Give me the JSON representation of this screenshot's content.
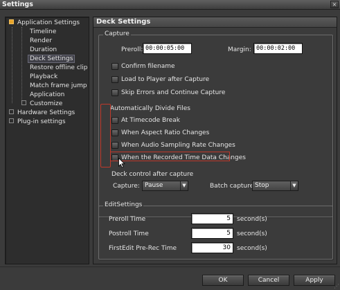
{
  "window": {
    "title": "Settings",
    "close_label": "×"
  },
  "tree": {
    "items": [
      {
        "label": "Application Settings",
        "level": 0
      },
      {
        "label": "Timeline",
        "level": 1
      },
      {
        "label": "Render",
        "level": 1
      },
      {
        "label": "Duration",
        "level": 1
      },
      {
        "label": "Deck Settings",
        "level": 1,
        "selected": true
      },
      {
        "label": "Restore offline clip",
        "level": 1
      },
      {
        "label": "Playback",
        "level": 1
      },
      {
        "label": "Match frame jump",
        "level": 1
      },
      {
        "label": "Application",
        "level": 1
      },
      {
        "label": "Customize",
        "level": 1
      },
      {
        "label": "Hardware Settings",
        "level": 0
      },
      {
        "label": "Plug-in settings",
        "level": 0
      }
    ]
  },
  "panel": {
    "title": "Deck Settings",
    "capture": {
      "legend": "Capture",
      "preroll_label": "Preroll:",
      "preroll_value": "00:00:05:00",
      "margin_label": "Margin:",
      "margin_value": "00:00:02:00",
      "confirm_filename": "Confirm filename",
      "load_to_player": "Load to Player after Capture",
      "skip_errors": "Skip Errors and Continue Capture",
      "auto_divide_label": "Automatically Divide Files",
      "at_timecode_break": "At Timecode Break",
      "aspect_ratio_changes": "When Aspect Ratio Changes",
      "audio_sampling_changes": "When Audio Sampling Rate Changes",
      "recorded_time_changes": "When the Recorded Time Data Changes",
      "deck_control_label": "Deck control after capture",
      "capture_label": "Capture:",
      "capture_value": "Pause",
      "batch_capture_label": "Batch capture:",
      "batch_capture_value": "Stop"
    },
    "edit": {
      "legend": "EditSettings",
      "unit": "second(s)",
      "rows": [
        {
          "label": "Preroll Time",
          "value": "5"
        },
        {
          "label": "Postroll Time",
          "value": "5"
        },
        {
          "label": "FirstEdit Pre-Rec Time",
          "value": "30"
        }
      ]
    }
  },
  "buttons": {
    "ok": "OK",
    "cancel": "Cancel",
    "apply": "Apply"
  }
}
